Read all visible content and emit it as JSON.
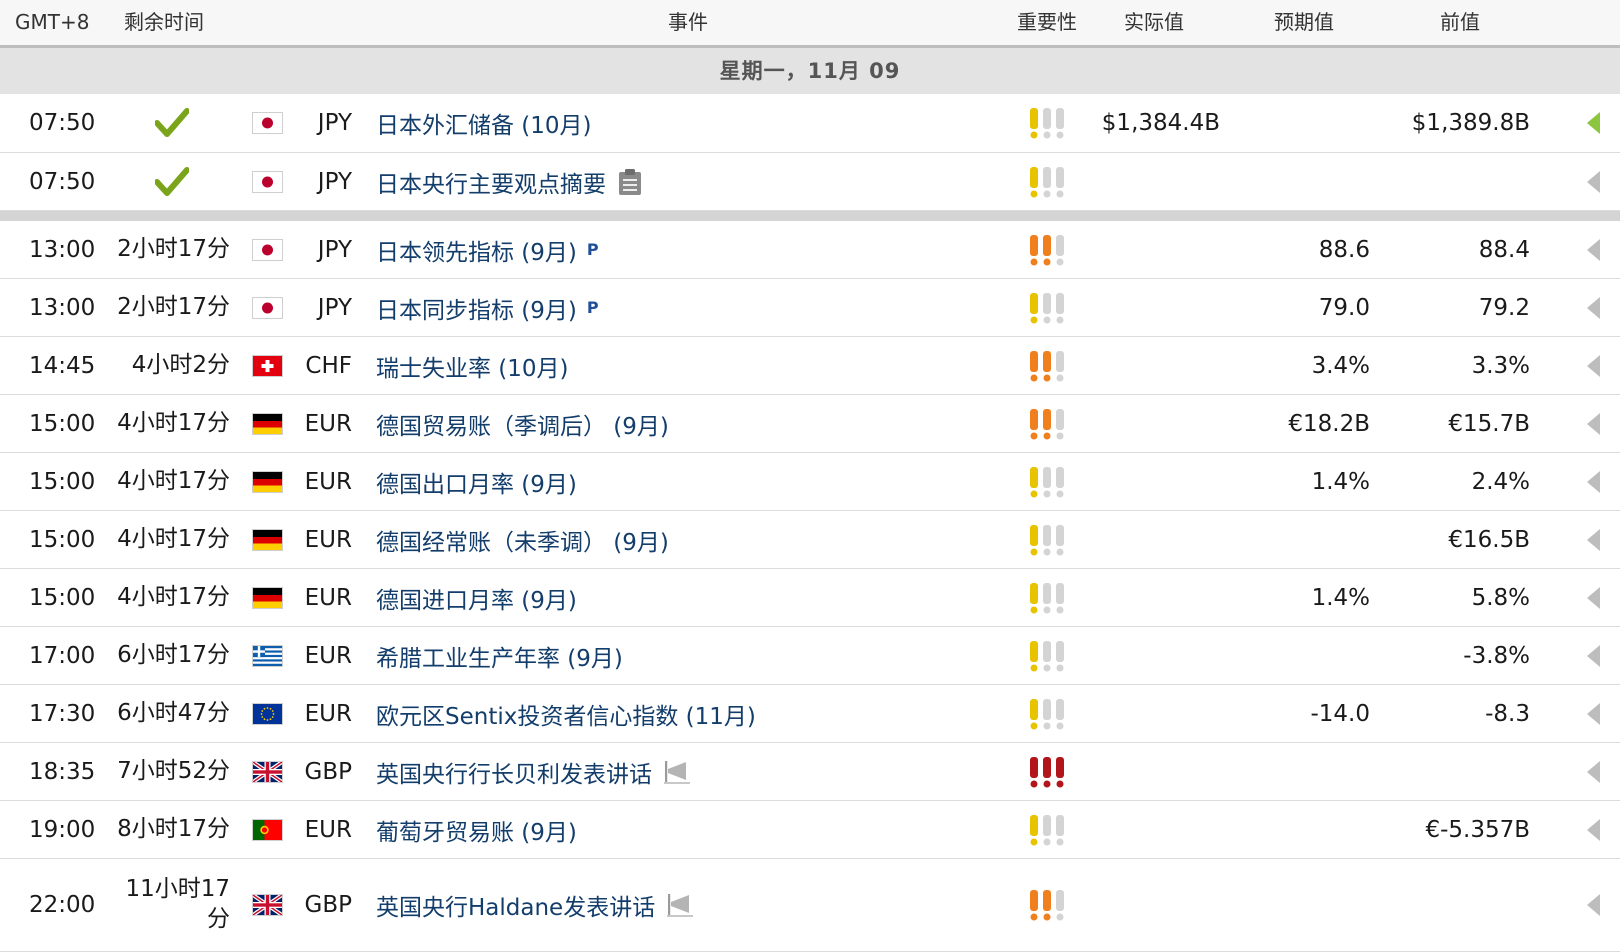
{
  "header": {
    "timezone": "GMT+8",
    "remaining": "剩余时间",
    "event": "事件",
    "importance": "重要性",
    "actual": "实际值",
    "forecast": "预期值",
    "previous": "前值"
  },
  "date_label": "星期一，11月 09",
  "colors": {
    "event_link": "#133d6b",
    "check": "#7aa51b",
    "imp_low": "#e8c300",
    "imp_medium": "#f07f1e",
    "imp_high": "#b2161a",
    "imp_inactive": "#d4d4d4",
    "arrow_active": "#8cc63f",
    "arrow_inactive": "#bdbdbd"
  },
  "rows": [
    {
      "time": "07:50",
      "remaining": "",
      "done": true,
      "flag": "jp",
      "currency": "JPY",
      "event": "日本外汇储备 (10月)",
      "badge": "",
      "importance": 1,
      "actual": "$1,384.4B",
      "forecast": "",
      "previous": "$1,389.8B",
      "arrow": "active"
    },
    {
      "time": "07:50",
      "remaining": "",
      "done": true,
      "flag": "jp",
      "currency": "JPY",
      "event": "日本央行主要观点摘要",
      "badge": "report",
      "importance": 1,
      "actual": "",
      "forecast": "",
      "previous": "",
      "arrow": "inactive"
    },
    {
      "time": "13:00",
      "remaining": "2小时17分",
      "done": false,
      "flag": "jp",
      "currency": "JPY",
      "event": "日本领先指标 (9月)",
      "badge": "preliminary",
      "badge_text": "P",
      "importance": 2,
      "actual": "",
      "forecast": "88.6",
      "previous": "88.4",
      "arrow": "inactive"
    },
    {
      "time": "13:00",
      "remaining": "2小时17分",
      "done": false,
      "flag": "jp",
      "currency": "JPY",
      "event": "日本同步指标 (9月)",
      "badge": "preliminary",
      "badge_text": "P",
      "importance": 1,
      "actual": "",
      "forecast": "79.0",
      "previous": "79.2",
      "arrow": "inactive"
    },
    {
      "time": "14:45",
      "remaining": "4小时2分",
      "done": false,
      "flag": "ch",
      "currency": "CHF",
      "event": "瑞士失业率 (10月)",
      "badge": "",
      "importance": 2,
      "actual": "",
      "forecast": "3.4%",
      "previous": "3.3%",
      "arrow": "inactive"
    },
    {
      "time": "15:00",
      "remaining": "4小时17分",
      "done": false,
      "flag": "de",
      "currency": "EUR",
      "event": "德国贸易账（季调后） (9月)",
      "badge": "",
      "importance": 2,
      "actual": "",
      "forecast": "€18.2B",
      "previous": "€15.7B",
      "arrow": "inactive"
    },
    {
      "time": "15:00",
      "remaining": "4小时17分",
      "done": false,
      "flag": "de",
      "currency": "EUR",
      "event": "德国出口月率 (9月)",
      "badge": "",
      "importance": 1,
      "actual": "",
      "forecast": "1.4%",
      "previous": "2.4%",
      "arrow": "inactive"
    },
    {
      "time": "15:00",
      "remaining": "4小时17分",
      "done": false,
      "flag": "de",
      "currency": "EUR",
      "event": "德国经常账（未季调） (9月)",
      "badge": "",
      "importance": 1,
      "actual": "",
      "forecast": "",
      "previous": "€16.5B",
      "arrow": "inactive"
    },
    {
      "time": "15:00",
      "remaining": "4小时17分",
      "done": false,
      "flag": "de",
      "currency": "EUR",
      "event": "德国进口月率 (9月)",
      "badge": "",
      "importance": 1,
      "actual": "",
      "forecast": "1.4%",
      "previous": "5.8%",
      "arrow": "inactive"
    },
    {
      "time": "17:00",
      "remaining": "6小时17分",
      "done": false,
      "flag": "gr",
      "currency": "EUR",
      "event": "希腊工业生产年率 (9月)",
      "badge": "",
      "importance": 1,
      "actual": "",
      "forecast": "",
      "previous": "-3.8%",
      "arrow": "inactive"
    },
    {
      "time": "17:30",
      "remaining": "6小时47分",
      "done": false,
      "flag": "eu",
      "currency": "EUR",
      "event": "欧元区Sentix投资者信心指数 (11月)",
      "badge": "",
      "importance": 1,
      "actual": "",
      "forecast": "-14.0",
      "previous": "-8.3",
      "arrow": "inactive"
    },
    {
      "time": "18:35",
      "remaining": "7小时52分",
      "done": false,
      "flag": "gb",
      "currency": "GBP",
      "event": "英国央行行长贝利发表讲话",
      "badge": "speech",
      "importance": 3,
      "actual": "",
      "forecast": "",
      "previous": "",
      "arrow": "inactive"
    },
    {
      "time": "19:00",
      "remaining": "8小时17分",
      "done": false,
      "flag": "pt",
      "currency": "EUR",
      "event": "葡萄牙贸易账 (9月)",
      "badge": "",
      "importance": 1,
      "actual": "",
      "forecast": "",
      "previous": "€-5.357B",
      "arrow": "inactive"
    },
    {
      "time": "22:00",
      "remaining": "11小时17分",
      "remaining_lines": [
        "11小时17",
        "分"
      ],
      "done": false,
      "flag": "gb",
      "currency": "GBP",
      "event": "英国央行Haldane发表讲话",
      "badge": "speech",
      "importance": 2,
      "actual": "",
      "forecast": "",
      "previous": "",
      "arrow": "inactive"
    }
  ]
}
